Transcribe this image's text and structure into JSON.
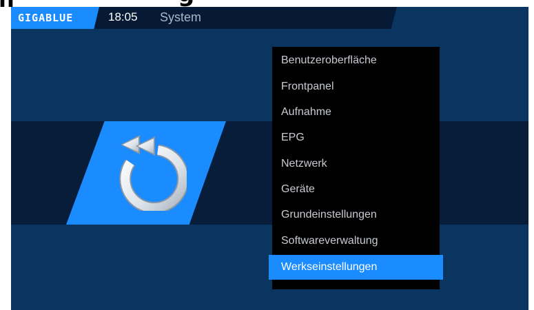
{
  "header": {
    "brand_logo_text": "GIGABLUE",
    "clock": "18:05",
    "title": "System"
  },
  "clipped_text": {
    "left_glyph": "n",
    "middle_glyph": "g"
  },
  "restore_panel": {
    "icon": "restore-arrow-icon"
  },
  "menu": {
    "selected_index": 8,
    "items": [
      {
        "label": "Benutzeroberfläche"
      },
      {
        "label": "Frontpanel"
      },
      {
        "label": "Aufnahme"
      },
      {
        "label": "EPG"
      },
      {
        "label": "Netzwerk"
      },
      {
        "label": "Geräte"
      },
      {
        "label": "Grundeinstellungen"
      },
      {
        "label": "Softwareverwaltung"
      },
      {
        "label": "Werkseinstellungen"
      }
    ]
  },
  "colors": {
    "background": "#0a3560",
    "band": "#071d3a",
    "accent": "#1a8cff",
    "menu_background": "#000000"
  }
}
